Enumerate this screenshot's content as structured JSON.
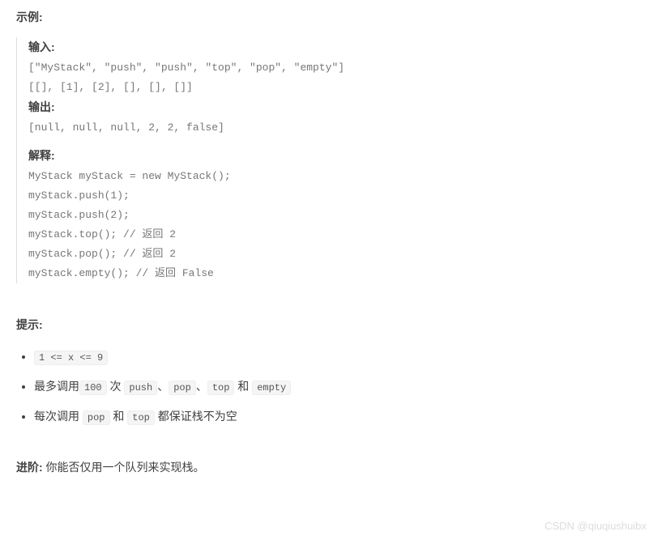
{
  "example_section": "示例:",
  "labels": {
    "input": "输入:",
    "output": "输出:",
    "explain": "解释:"
  },
  "input_line1": "[\"MyStack\", \"push\", \"push\", \"top\", \"pop\", \"empty\"]",
  "input_line2": "[[], [1], [2], [], [], []]",
  "output_line": "[null, null, null, 2, 2, false]",
  "explain_lines": [
    "MyStack myStack = new MyStack();",
    "myStack.push(1);",
    "myStack.push(2);",
    "myStack.top(); // 返回 2",
    "myStack.pop(); // 返回 2",
    "myStack.empty(); // 返回 False"
  ],
  "hints_section": "提示:",
  "hints": {
    "item1_code": "1 <= x <= 9",
    "item2_pre": "最多调用",
    "item2_code1": "100",
    "item2_mid": " 次 ",
    "item2_code2": "push",
    "item2_sep": "、",
    "item2_code3": "pop",
    "item2_code4": "top",
    "item2_and": " 和 ",
    "item2_code5": "empty",
    "item3_pre": "每次调用 ",
    "item3_code1": "pop",
    "item3_mid": " 和 ",
    "item3_code2": "top",
    "item3_post": " 都保证栈不为空"
  },
  "advanced_label": "进阶:",
  "advanced_text": " 你能否仅用一个队列来实现栈。",
  "watermark": "CSDN @qiuqiushuibx"
}
